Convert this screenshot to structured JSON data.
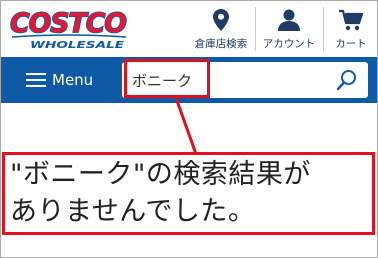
{
  "header": {
    "logo_top": "COSTCO",
    "logo_bottom": "WHOLESALE",
    "nav": [
      {
        "label": "倉庫店検索",
        "icon": "location-pin-icon"
      },
      {
        "label": "アカウント",
        "icon": "person-icon"
      },
      {
        "label": "カート",
        "icon": "cart-icon"
      }
    ]
  },
  "toolbar": {
    "menu_label": "Menu",
    "search_value": "ボニーク"
  },
  "result": {
    "message_line1": "\"ボニーク\"の検索結果が",
    "message_line2": "ありませんでした。"
  },
  "colors": {
    "brand_blue": "#0f5aa6",
    "brand_red": "#e31837",
    "highlight_red": "#e0101c",
    "nav_text": "#1f3c67"
  }
}
